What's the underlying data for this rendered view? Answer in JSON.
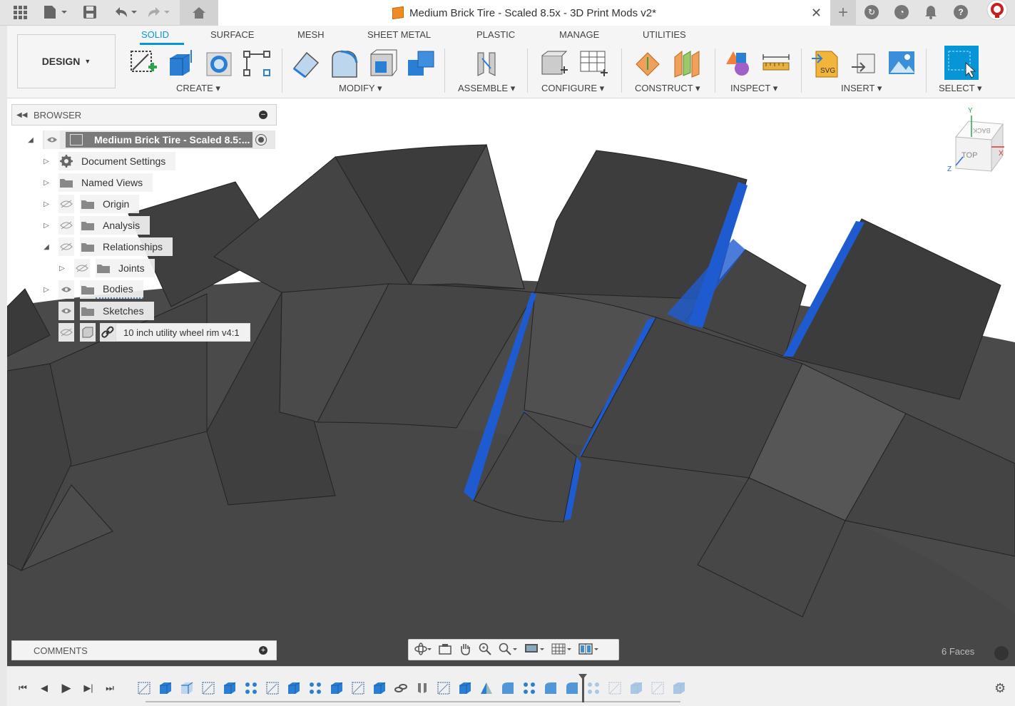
{
  "titlebar": {
    "document_title": "Medium Brick Tire - Scaled 8.5x - 3D Print Mods v2*"
  },
  "toolbar": {
    "workspace": "DESIGN",
    "tabs": [
      "SOLID",
      "SURFACE",
      "MESH",
      "SHEET METAL",
      "PLASTIC",
      "MANAGE",
      "UTILITIES"
    ],
    "active_tab": "SOLID",
    "groups": [
      "CREATE",
      "MODIFY",
      "ASSEMBLE",
      "CONFIGURE",
      "CONSTRUCT",
      "INSPECT",
      "INSERT",
      "SELECT"
    ]
  },
  "browser": {
    "title": "BROWSER",
    "root": "Medium Brick Tire - Scaled 8.5:...",
    "items": [
      {
        "label": "Document Settings",
        "icon": "gear-icon"
      },
      {
        "label": "Named Views",
        "icon": "folder-icon"
      },
      {
        "label": "Origin",
        "icon": "folder-icon"
      },
      {
        "label": "Analysis",
        "icon": "folder-icon"
      },
      {
        "label": "Relationships",
        "icon": "folder-icon"
      },
      {
        "label": "Joints",
        "icon": "folder-icon"
      },
      {
        "label": "Bodies",
        "icon": "folder-icon"
      },
      {
        "label": "Sketches",
        "icon": "folder-icon"
      },
      {
        "label": "10 inch utility wheel rim v4:1",
        "icon": "component-link-icon"
      }
    ]
  },
  "comments": {
    "title": "COMMENTS"
  },
  "viewcube": {
    "top_label": "TOP",
    "back_label": "BACK",
    "axis_x": "X",
    "axis_y": "Y",
    "axis_z": "Z"
  },
  "status": {
    "selection": "6 Faces"
  },
  "colors": {
    "accent": "#0696d7",
    "selection_blue": "#1f5bd0",
    "tire_dark": "#484848"
  }
}
